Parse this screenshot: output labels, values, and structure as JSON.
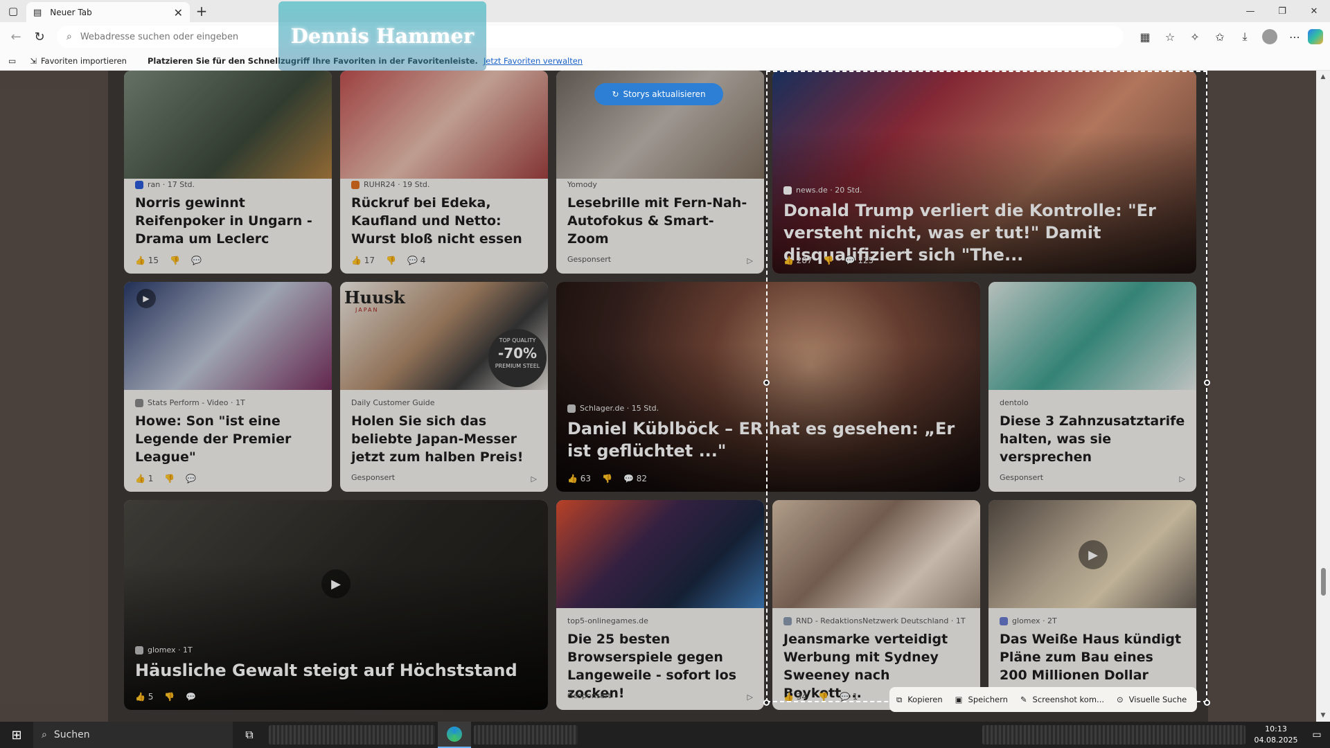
{
  "browser": {
    "tab_title": "Neuer Tab",
    "address_placeholder": "Webadresse suchen oder eingeben",
    "favbar_import": "Favoriten importieren",
    "favbar_hint": "Platzieren Sie für den Schnellzugriff Ihre Favoriten in der Favoritenleiste.",
    "favbar_link": "Jetzt Favoriten verwalten",
    "logo_text": "Dennis Hammer"
  },
  "feed": {
    "refresh_label": "Storys aktualisieren",
    "cards": [
      {
        "source": "ran · 17 Std.",
        "title": "Norris gewinnt Reifenpoker in Ungarn - Drama um Leclerc",
        "likes": "15",
        "comments": ""
      },
      {
        "source": "RUHR24 · 19 Std.",
        "title": "Rückruf bei Edeka, Kaufland und Netto: Wurst bloß nicht essen",
        "likes": "17",
        "comments": "4"
      },
      {
        "source": "Yomody",
        "title": "Lesebrille mit Fern-Nah-Autofokus & Smart-Zoom",
        "sponsored": "Gesponsert"
      },
      {
        "source": "news.de · 20 Std.",
        "title": "Donald Trump verliert die Kontrolle: \"Er versteht nicht, was er tut!\" Damit disqualifiziert sich \"The...",
        "likes": "287",
        "comments": "125"
      },
      {
        "source": "Stats Perform - Video · 1T",
        "title": "Howe: Son \"ist eine Legende der Premier League\"",
        "likes": "1",
        "comments": ""
      },
      {
        "source": "Daily Customer Guide",
        "title": "Holen Sie sich das beliebte Japan-Messer jetzt zum halben Preis!",
        "sponsored": "Gesponsert"
      },
      {
        "source": "Schlager.de · 15 Std.",
        "title": "Daniel Küblböck – ER hat es gesehen: „Er ist geflüchtet ...\"",
        "likes": "63",
        "comments": "82"
      },
      {
        "source": "dentolo",
        "title": "Diese 3 Zahnzusatztarife halten, was sie versprechen",
        "sponsored": "Gesponsert"
      },
      {
        "source": "glomex · 1T",
        "title": "Häusliche Gewalt steigt auf Höchststand",
        "likes": "5",
        "comments": ""
      },
      {
        "source": "top5-onlinegames.de",
        "title": "Die 25 besten Browserspiele gegen Langeweile - sofort los zocken!",
        "sponsored": "Gesponsert"
      },
      {
        "source": "RND - RedaktionsNetzwerk Deutschland · 1T",
        "title": "Jeansmarke verteidigt Werbung mit Sydney Sweeney nach Boykott-...",
        "likes": "34",
        "comments": "1"
      },
      {
        "source": "glomex · 2T",
        "title": "Das Weiße Haus kündigt Pläne zum Bau eines 200 Millionen Dollar teuren..."
      }
    ]
  },
  "image_text": {
    "ad_knife_brand": "Huusk",
    "ad_knife_sub": "JAPAN",
    "ad_knife_badge_top": "TOP QUALITY",
    "ad_knife_badge_pct": "-70%",
    "ad_knife_badge_bottom": "PREMIUM STEEL"
  },
  "snip_menu": {
    "copy": "Kopieren",
    "save": "Speichern",
    "annotate": "Screenshot kom...",
    "visual_search": "Visuelle Suche"
  },
  "taskbar": {
    "search_label": "Suchen",
    "time": "10:13",
    "date": "04.08.2025"
  }
}
